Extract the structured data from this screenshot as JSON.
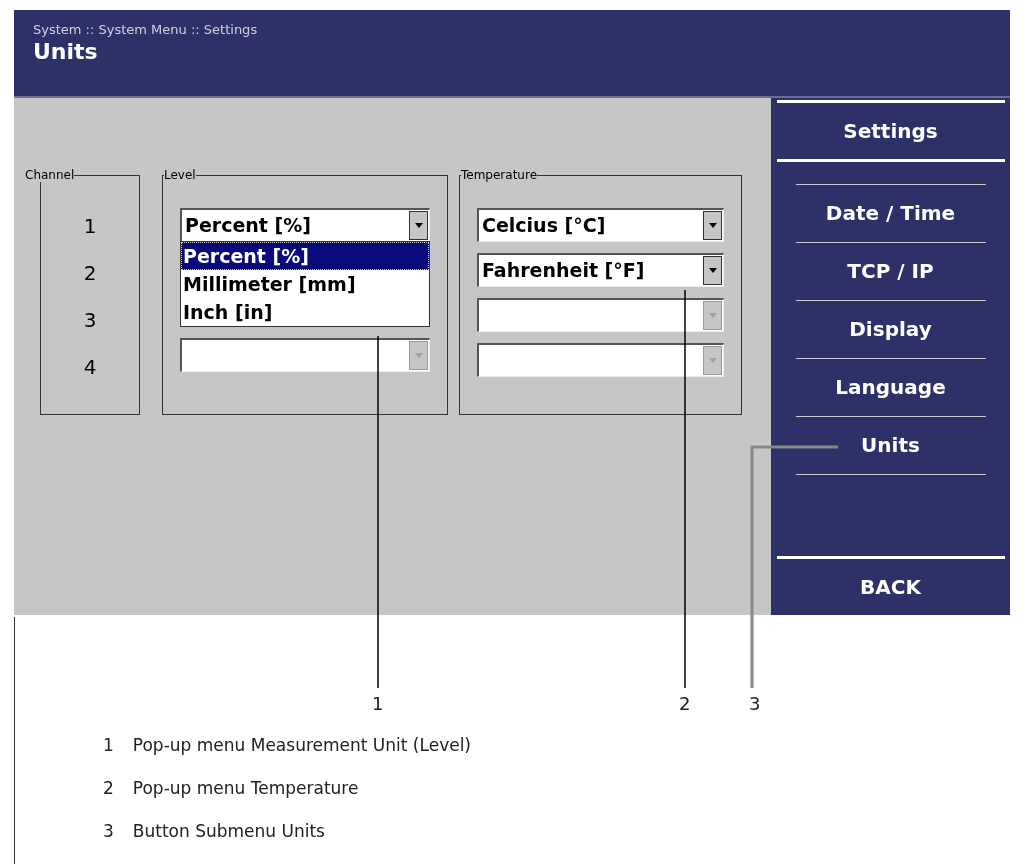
{
  "header": {
    "breadcrumb": "System :: System Menu :: Settings",
    "title": "Units"
  },
  "channel_group": {
    "label": "Channel",
    "channels": [
      "1",
      "2",
      "3",
      "4"
    ]
  },
  "level_group": {
    "label": "Level",
    "dropdowns": [
      {
        "value": "Percent [%]",
        "disabled": false
      },
      {
        "disabled": true
      }
    ],
    "popup": [
      {
        "label": "Percent [%]",
        "selected": true
      },
      {
        "label": "Millimeter [mm]",
        "selected": false
      },
      {
        "label": "Inch [in]",
        "selected": false
      }
    ]
  },
  "temperature_group": {
    "label": "Temperature",
    "dropdowns": [
      {
        "value": "Celcius [°C]",
        "disabled": false
      },
      {
        "value": "Fahrenheit [°F]",
        "disabled": false
      },
      {
        "disabled": true
      },
      {
        "disabled": true
      }
    ]
  },
  "sidebar": {
    "title": "Settings",
    "items": [
      "Date / Time",
      "TCP / IP",
      "Display",
      "Language",
      "Units"
    ],
    "back": "BACK"
  },
  "callouts": [
    "1",
    "2",
    "3"
  ],
  "legend": [
    {
      "number": "1",
      "text": "Pop-up menu Measurement Unit (Level)"
    },
    {
      "number": "2",
      "text": "Pop-up menu Temperature"
    },
    {
      "number": "3",
      "text": "Button Submenu Units"
    }
  ]
}
